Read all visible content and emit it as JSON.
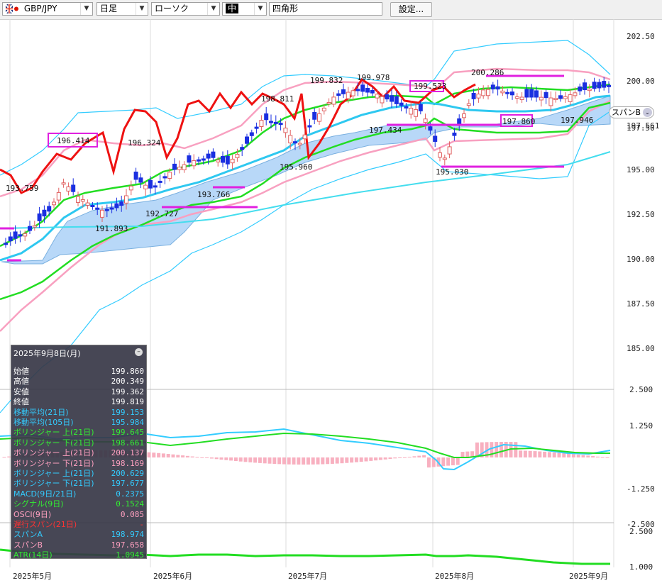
{
  "toolbar": {
    "symbol": "GBP/JPY",
    "timeframe": "日足",
    "chart_type": "ローソク",
    "line_width": "中",
    "drawing_tool": "四角形",
    "settings_label": "設定..."
  },
  "colors": {
    "accent_magenta": "#e020e0",
    "ma_short": "#2ec8f0",
    "ma_long": "#22dd22",
    "candle_up": "#f08080",
    "candle_down": "#1a2fe0",
    "cloud": "#b8d8f8"
  },
  "y_axis": [
    "202.50",
    "200.00",
    "197.561",
    "197.50",
    "195.00",
    "192.50",
    "190.00",
    "187.50",
    "185.00",
    "2.500",
    "1.250",
    "-1.250",
    "-2.500",
    "2.500",
    "1.000"
  ],
  "x_axis": [
    "2025年5月",
    "2025年6月",
    "2025年7月",
    "2025年8月",
    "2025年9月"
  ],
  "span_b_tag": "スパンB",
  "span_b_icon": "chevron-down-icon",
  "annotations": [
    "193.759",
    "196.414",
    "196.324",
    "191.893",
    "192.727",
    "193.766",
    "198.811",
    "195.960",
    "199.832",
    "199.978",
    "197.434",
    "199.523",
    "195.030",
    "200.286",
    "197.860",
    "197.946"
  ],
  "info": {
    "date": "2025年9月8日(月)",
    "rows": [
      {
        "label": "始値",
        "value": "199.860",
        "color": "#ffffff"
      },
      {
        "label": "高値",
        "value": "200.349",
        "color": "#ffffff"
      },
      {
        "label": "安値",
        "value": "199.362",
        "color": "#ffffff"
      },
      {
        "label": "終値",
        "value": "199.819",
        "color": "#ffffff"
      },
      {
        "label": "移動平均(21日)",
        "value": "199.153",
        "color": "#33ccff"
      },
      {
        "label": "移動平均(105日)",
        "value": "195.984",
        "color": "#33ccff"
      },
      {
        "label": "ボリンジャー 上(21日)",
        "value": "199.645",
        "color": "#33ee33"
      },
      {
        "label": "ボリンジャー 下(21日)",
        "value": "198.661",
        "color": "#33ee33"
      },
      {
        "label": "ボリンジャー 上(21日)",
        "value": "200.137",
        "color": "#ffa0c0"
      },
      {
        "label": "ボリンジャー 下(21日)",
        "value": "198.169",
        "color": "#ffa0c0"
      },
      {
        "label": "ボリンジャー 上(21日)",
        "value": "200.629",
        "color": "#33ccff"
      },
      {
        "label": "ボリンジャー 下(21日)",
        "value": "197.677",
        "color": "#33ccff"
      },
      {
        "label": "MACD(9日/21日)",
        "value": "0.2375",
        "color": "#33ccff"
      },
      {
        "label": "シグナル(9日)",
        "value": "0.1524",
        "color": "#33ee33"
      },
      {
        "label": "OSCI(9日)",
        "value": "0.085",
        "color": "#ffa0c0"
      },
      {
        "label": "遅行スパン(21日)",
        "value": "-",
        "color": "#ff3333"
      },
      {
        "label": "スパンA",
        "value": "198.974",
        "color": "#33ccff"
      },
      {
        "label": "スパンB",
        "value": "197.658",
        "color": "#ffa0c0"
      },
      {
        "label": "ATR(14日)",
        "value": "1.0945",
        "color": "#33ee33"
      }
    ]
  },
  "chart_data": {
    "type": "line",
    "title": "",
    "symbol": "GBP/JPY",
    "x": [
      "2025-05-01",
      "2025-05-08",
      "2025-05-15",
      "2025-05-22",
      "2025-05-29",
      "2025-06-05",
      "2025-06-12",
      "2025-06-19",
      "2025-06-26",
      "2025-07-03",
      "2025-07-10",
      "2025-07-17",
      "2025-07-24",
      "2025-07-31",
      "2025-08-07",
      "2025-08-14",
      "2025-08-21",
      "2025-08-28",
      "2025-09-04",
      "2025-09-08"
    ],
    "series": [
      {
        "name": "移動平均(21日)",
        "values": [
          190.2,
          191.0,
          192.6,
          193.4,
          193.6,
          193.9,
          194.6,
          195.0,
          195.7,
          196.5,
          197.3,
          198.2,
          198.5,
          198.4,
          198.4,
          198.7,
          198.8,
          198.9,
          199.0,
          199.15
        ]
      },
      {
        "name": "移動平均(105日)",
        "values": [
          192.8,
          192.8,
          192.9,
          193.0,
          193.1,
          193.3,
          193.6,
          193.9,
          194.2,
          194.6,
          195.0,
          195.3,
          195.6,
          195.8,
          195.9,
          196.0,
          196.0,
          196.0,
          196.0,
          195.98
        ]
      },
      {
        "name": "遅行スパン(21日)",
        "values": [
          195.2,
          193.8,
          196.4,
          195.5,
          196.9,
          197.7,
          197.8,
          198.6,
          199.0,
          198.5,
          199.8,
          199.9,
          199.3,
          199.1,
          199.6,
          199.8
        ]
      }
    ],
    "oscillator": {
      "name": "MACD(9日/21日)",
      "ylim": [
        -2.5,
        2.5
      ]
    },
    "atr": {
      "name": "ATR(14日)",
      "ylim": [
        1.0,
        2.5
      ]
    },
    "ylim": [
      184.4,
      203.8
    ],
    "grid": false
  }
}
